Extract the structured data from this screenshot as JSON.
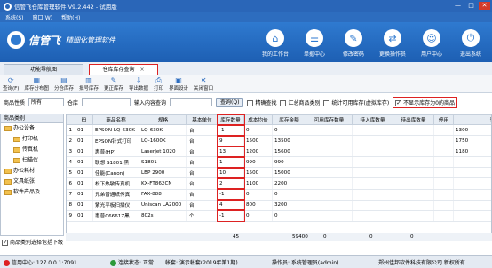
{
  "window": {
    "title": "信管飞仓库管理软件 V9.2.442 - 试用版",
    "minimize": "—",
    "maximize": "□",
    "close": "✕"
  },
  "menu": [
    "系统(S)",
    "窗口(W)",
    "帮助(H)"
  ],
  "banner": {
    "brand": "信管飞",
    "slogan": "精细化管理软件"
  },
  "topnav": [
    {
      "label": "我的工作台",
      "icon": "⌂"
    },
    {
      "label": "单据中心",
      "icon": "☰"
    },
    {
      "label": "修改密码",
      "icon": "✎"
    },
    {
      "label": "更换操作员",
      "icon": "⇄"
    },
    {
      "label": "用户中心",
      "icon": "☺"
    },
    {
      "label": "退出系统",
      "icon": "⏻"
    }
  ],
  "tabs": [
    {
      "label": "功能导航图"
    },
    {
      "label": "仓库库存查询",
      "close": "×"
    }
  ],
  "toolbar": [
    {
      "label": "查询(F)",
      "icon": "⟳"
    },
    {
      "label": "库存分布图",
      "icon": "▦"
    },
    {
      "label": "分仓库存",
      "icon": "▤"
    },
    {
      "label": "批号库存",
      "icon": "▥"
    },
    {
      "label": "更正库存",
      "icon": "✎"
    },
    {
      "label": "导出数据",
      "icon": "⇩"
    },
    {
      "label": "打印",
      "icon": "⎙"
    },
    {
      "label": "界面设计",
      "icon": "▣"
    },
    {
      "label": "关闭窗口",
      "icon": "✕"
    }
  ],
  "filter": {
    "product_label": "商品性质",
    "product_value": "所有",
    "warehouse_label": "仓库",
    "warehouse_value": "",
    "content_label": "输入内容查询",
    "content_value": "",
    "query_button": "查询(Q)",
    "exact": "精确查找",
    "summary": "汇总商品类别",
    "stat_available": "统计可用库存(虚拟库存)",
    "hide_zero": "不显示库存为0的商品"
  },
  "tree": {
    "header": "商品类别",
    "items": [
      "办公设备",
      "打印机",
      "传真机",
      "扫描仪",
      "办公耗材",
      "文具纸张",
      "软件产品及"
    ]
  },
  "bottom_check": "商品类别选择包括下级",
  "grid": {
    "columns": [
      "",
      "码",
      "商品名称",
      "规格",
      "基本单位",
      "库存数量",
      "成本均价",
      "库存金额",
      "可用库存数量",
      "待入库数量",
      "待出库数量",
      "停用",
      "预设售价"
    ],
    "rows": [
      [
        "1",
        "01",
        "EPSON LQ-630K",
        "LQ-630K",
        "台",
        "-1",
        "0",
        "0",
        "",
        "",
        "",
        "",
        "1300"
      ],
      [
        "2",
        "01",
        "EPSON针式打印",
        "LQ-1600K",
        "台",
        "9",
        "1500",
        "13500",
        "",
        "",
        "",
        "",
        "1750"
      ],
      [
        "3",
        "01",
        "惠普(HP)",
        "LaserJet 1020",
        "台",
        "13",
        "1200",
        "15600",
        "",
        "",
        "",
        "",
        "1180"
      ],
      [
        "4",
        "01",
        "联想 S1801 黑",
        "S1801",
        "台",
        "1",
        "990",
        "990",
        "",
        "",
        "",
        "",
        ""
      ],
      [
        "5",
        "01",
        "佳能(Canon)",
        "LBP 2900",
        "台",
        "10",
        "1500",
        "15000",
        "",
        "",
        "",
        "",
        ""
      ],
      [
        "6",
        "01",
        "松下热敏传真机",
        "KX-FT862CN",
        "台",
        "2",
        "1100",
        "2200",
        "",
        "",
        "",
        "",
        ""
      ],
      [
        "7",
        "01",
        "兄弟普通纸传真",
        "FAX-888",
        "台",
        "-1",
        "0",
        "0",
        "",
        "",
        "",
        "",
        ""
      ],
      [
        "8",
        "01",
        "紫光平板扫描仪",
        "Uniscan LA2000",
        "台",
        "4",
        "800",
        "3200",
        "",
        "",
        "",
        "",
        ""
      ],
      [
        "9",
        "01",
        "惠普C6661Z黑",
        "802s",
        "个",
        "-1",
        "0",
        "0",
        "",
        "",
        "",
        "",
        ""
      ]
    ]
  },
  "summary": {
    "qty": "45",
    "amount": "59400",
    "zero1": "0",
    "zero2": "0",
    "zero3": "0"
  },
  "status": {
    "server": "信用中心: 127.0.0.1:7091",
    "conn": "连接状态: 正常",
    "account": "帐套: 演示帐套(2019年第1期)",
    "operator": "操作员: 系统管理员(admin)",
    "company": "郑州佳邦软件科技有限公司 新权所有"
  }
}
